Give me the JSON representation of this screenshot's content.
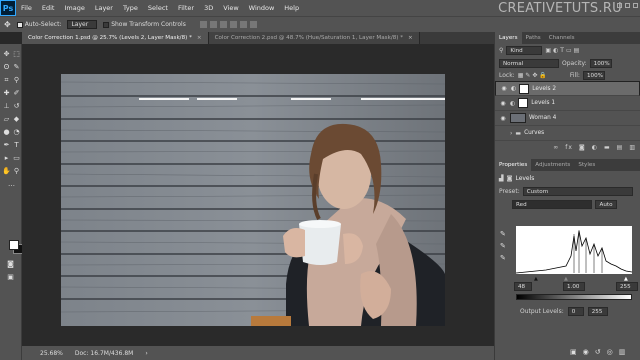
{
  "app": {
    "logo": "Ps",
    "watermark": "CREATIVETUTS.RU"
  },
  "menu": [
    "File",
    "Edit",
    "Image",
    "Layer",
    "Type",
    "Select",
    "Filter",
    "3D",
    "View",
    "Window",
    "Help"
  ],
  "options": {
    "auto_select_label": "Auto-Select:",
    "auto_select_value": "Layer",
    "transform_label": "Show Transform Controls"
  },
  "tabs": [
    {
      "label": "Color Correction 1.psd @ 25.7% (Levels 2, Layer Mask/8) *",
      "active": true
    },
    {
      "label": "Color Correction 2.psd @ 48.7% (Hue/Saturation 1, Layer Mask/8) *",
      "active": false
    }
  ],
  "status": {
    "zoom": "25.68%",
    "doc": "Doc: 16.7M/436.8M"
  },
  "layers_panel": {
    "tabs": [
      "Layers",
      "Paths",
      "Channels"
    ],
    "kind": "Kind",
    "blend": "Normal",
    "opacity_label": "Opacity:",
    "opacity": "100%",
    "lock_label": "Lock:",
    "fill_label": "Fill:",
    "fill": "100%",
    "layers": [
      "Levels 2",
      "Levels 1",
      "Woman 4",
      "Curves"
    ]
  },
  "properties_panel": {
    "tabs": [
      "Properties",
      "Adjustments",
      "Styles"
    ],
    "title": "Levels",
    "preset_label": "Preset:",
    "preset": "Custom",
    "channel": "Red",
    "auto": "Auto",
    "input": [
      "48",
      "1.00",
      "255"
    ],
    "output_label": "Output Levels:",
    "output": [
      "0",
      "255"
    ]
  },
  "colors": {
    "chrome": "#535353",
    "canvas": "#2a2a2a",
    "accent": "#31a8ff"
  }
}
